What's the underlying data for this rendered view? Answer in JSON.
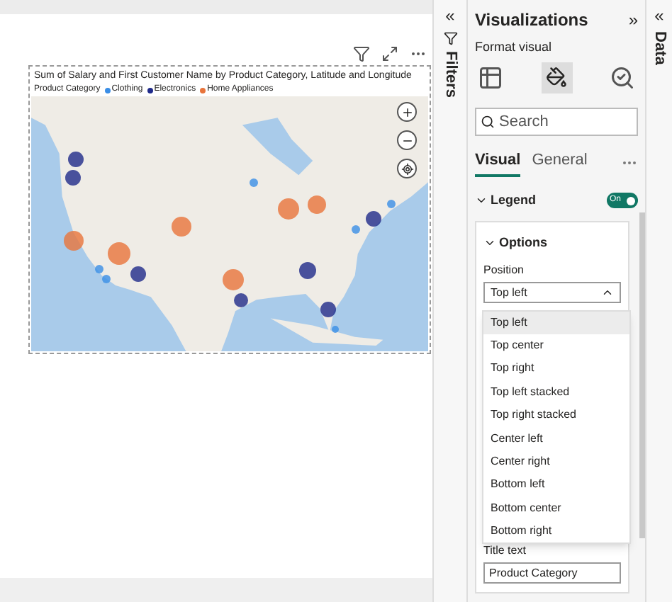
{
  "visual": {
    "title": "Sum of Salary and First Customer Name by Product Category, Latitude and Longitude",
    "legend_title": "Product Category",
    "legend": [
      {
        "label": "Clothing",
        "color": "#3a8ee6"
      },
      {
        "label": "Electronics",
        "color": "#1f2a8a"
      },
      {
        "label": "Home Appliances",
        "color": "#e8743b"
      }
    ]
  },
  "filters_pane": {
    "collapse": "«",
    "title": "Filters"
  },
  "visualizations": {
    "title": "Visualizations",
    "expand": "»",
    "subtitle": "Format visual",
    "search": {
      "placeholder": "Search"
    },
    "tabs": [
      {
        "label": "Visual",
        "selected": true
      },
      {
        "label": "General",
        "selected": false
      }
    ],
    "legend": {
      "label": "Legend",
      "expanded": true,
      "on": true,
      "toggle_text": "On"
    },
    "options": {
      "label": "Options",
      "expanded": true,
      "position_label": "Position",
      "position_value": "Top left",
      "position_options": [
        {
          "label": "Top left",
          "selected": true
        },
        {
          "label": "Top center",
          "selected": false
        },
        {
          "label": "Top right",
          "selected": false
        },
        {
          "label": "Top left stacked",
          "selected": false
        },
        {
          "label": "Top right stacked",
          "selected": false
        },
        {
          "label": "Center left",
          "selected": false
        },
        {
          "label": "Center right",
          "selected": false
        },
        {
          "label": "Bottom left",
          "selected": false
        },
        {
          "label": "Bottom center",
          "selected": false
        },
        {
          "label": "Bottom right",
          "selected": false
        }
      ],
      "title_text_label": "Title text",
      "title_text_value": "Product Category"
    }
  },
  "data_pane": {
    "collapse": "«",
    "title": "Data"
  }
}
